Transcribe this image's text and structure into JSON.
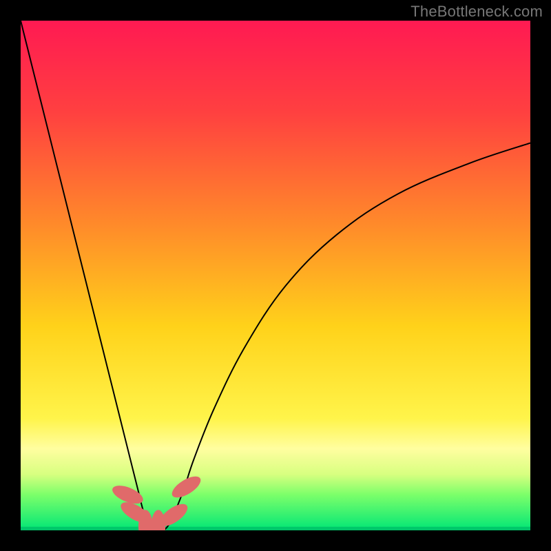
{
  "watermark": "TheBottleneck.com",
  "chart_data": {
    "type": "line",
    "title": "",
    "xlabel": "",
    "ylabel": "",
    "xlim": [
      0,
      100
    ],
    "ylim": [
      0,
      100
    ],
    "grid": false,
    "legend": false,
    "gradient_stops": [
      {
        "pct": 0,
        "color": "#ff1a52"
      },
      {
        "pct": 18,
        "color": "#ff4040"
      },
      {
        "pct": 40,
        "color": "#ff8a2a"
      },
      {
        "pct": 60,
        "color": "#ffd21a"
      },
      {
        "pct": 78,
        "color": "#fff44a"
      },
      {
        "pct": 84,
        "color": "#fffea0"
      },
      {
        "pct": 89,
        "color": "#d8ff80"
      },
      {
        "pct": 93,
        "color": "#7cff6a"
      },
      {
        "pct": 100,
        "color": "#00e676"
      }
    ],
    "series": [
      {
        "name": "bottleneck-curve",
        "color": "#000000",
        "width": 2,
        "x": [
          0,
          2,
          4,
          6,
          8,
          10,
          12,
          14,
          16,
          18,
          20,
          22,
          23,
          24,
          25,
          26,
          27,
          28,
          29,
          30,
          32,
          34,
          38,
          44,
          52,
          62,
          74,
          88,
          100
        ],
        "y": [
          100,
          92,
          84,
          76,
          68,
          60,
          52,
          44,
          36,
          28,
          20,
          12,
          8,
          4,
          1,
          0,
          0,
          0,
          1,
          3,
          8,
          14,
          24,
          36,
          48,
          58,
          66,
          72,
          76
        ]
      }
    ],
    "markers": {
      "name": "optimal-range-markers",
      "color": "#e06a6a",
      "points": [
        {
          "x": 21.0,
          "y": 7.0,
          "rot": -68
        },
        {
          "x": 22.5,
          "y": 3.5,
          "rot": -60
        },
        {
          "x": 24.5,
          "y": 0.8,
          "rot": 0
        },
        {
          "x": 27.0,
          "y": 0.8,
          "rot": 0
        },
        {
          "x": 30.0,
          "y": 3.0,
          "rot": 55
        },
        {
          "x": 32.5,
          "y": 8.5,
          "rot": 58
        }
      ],
      "rx": 1.4,
      "ry": 3.2
    }
  }
}
